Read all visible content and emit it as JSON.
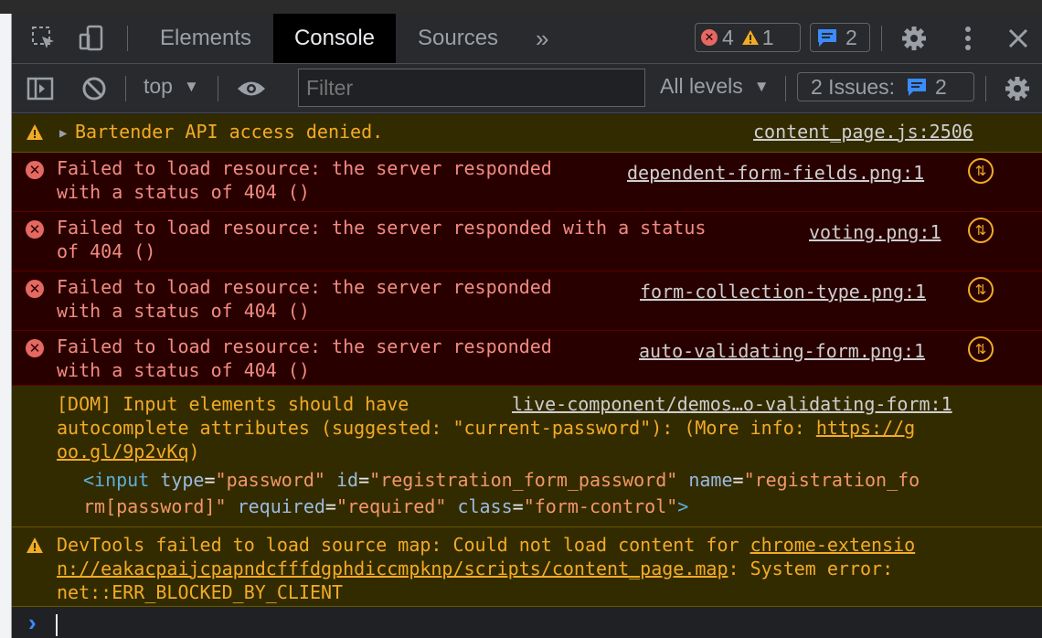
{
  "tabbar": {
    "tabs": [
      {
        "label": "Elements"
      },
      {
        "label": "Console"
      },
      {
        "label": "Sources"
      }
    ],
    "more_label": "»",
    "errors_count": "4",
    "warnings_count": "1",
    "messages_count": "2"
  },
  "toolbar": {
    "context": "top",
    "filter_placeholder": "Filter",
    "levels": "All levels",
    "issues_label": "2 Issues:",
    "issues_count": "2"
  },
  "messages": [
    {
      "level": "warning",
      "text": "Bartender API access denied.",
      "source": "content_page.js:2506"
    },
    {
      "level": "error",
      "line1": "Failed to load resource: the server responded",
      "line2": "with a status of 404 ()",
      "source": "dependent-form-fields.png:1"
    },
    {
      "level": "error",
      "line1": "Failed to load resource: the server responded with a status",
      "line2": "of 404 ()",
      "source": "voting.png:1"
    },
    {
      "level": "error",
      "line1": "Failed to load resource: the server responded",
      "line2": "with a status of 404 ()",
      "source": "form-collection-type.png:1"
    },
    {
      "level": "error",
      "line1": "Failed to load resource: the server responded",
      "line2": "with a status of 404 ()",
      "source": "auto-validating-form.png:1"
    },
    {
      "level": "warning",
      "line1": "[DOM] Input elements should have",
      "source": "live-component/demos…o-validating-form:1",
      "line2": "autocomplete attributes (suggested: \"current-password\"): (More info: ",
      "link_part1": "https://g",
      "link_part2": "oo.gl/9p2vKq",
      "line3_end": ")",
      "code": {
        "lt": "<",
        "tag": "input",
        "a1": "type",
        "v1": "\"password\"",
        "a2": "id",
        "v2": "\"registration_form_password\"",
        "a3": "name",
        "v3a": "\"registration_fo",
        "v3b": "rm[password]\"",
        "a4": "required",
        "v4": "\"required\"",
        "a5": "class",
        "v5": "\"form-control\"",
        "gt": ">",
        "eq": "="
      }
    },
    {
      "level": "warning",
      "line1": "DevTools failed to load source map: Could not load content for ",
      "link1": "chrome-extensio",
      "link2": "n://eakacpaijcpapndcfffdgphdiccmpknp/scripts/content_page.map",
      "line2_end": ": System error:",
      "line3": "net::ERR_BLOCKED_BY_CLIENT"
    }
  ],
  "prompt_symbol": "›"
}
